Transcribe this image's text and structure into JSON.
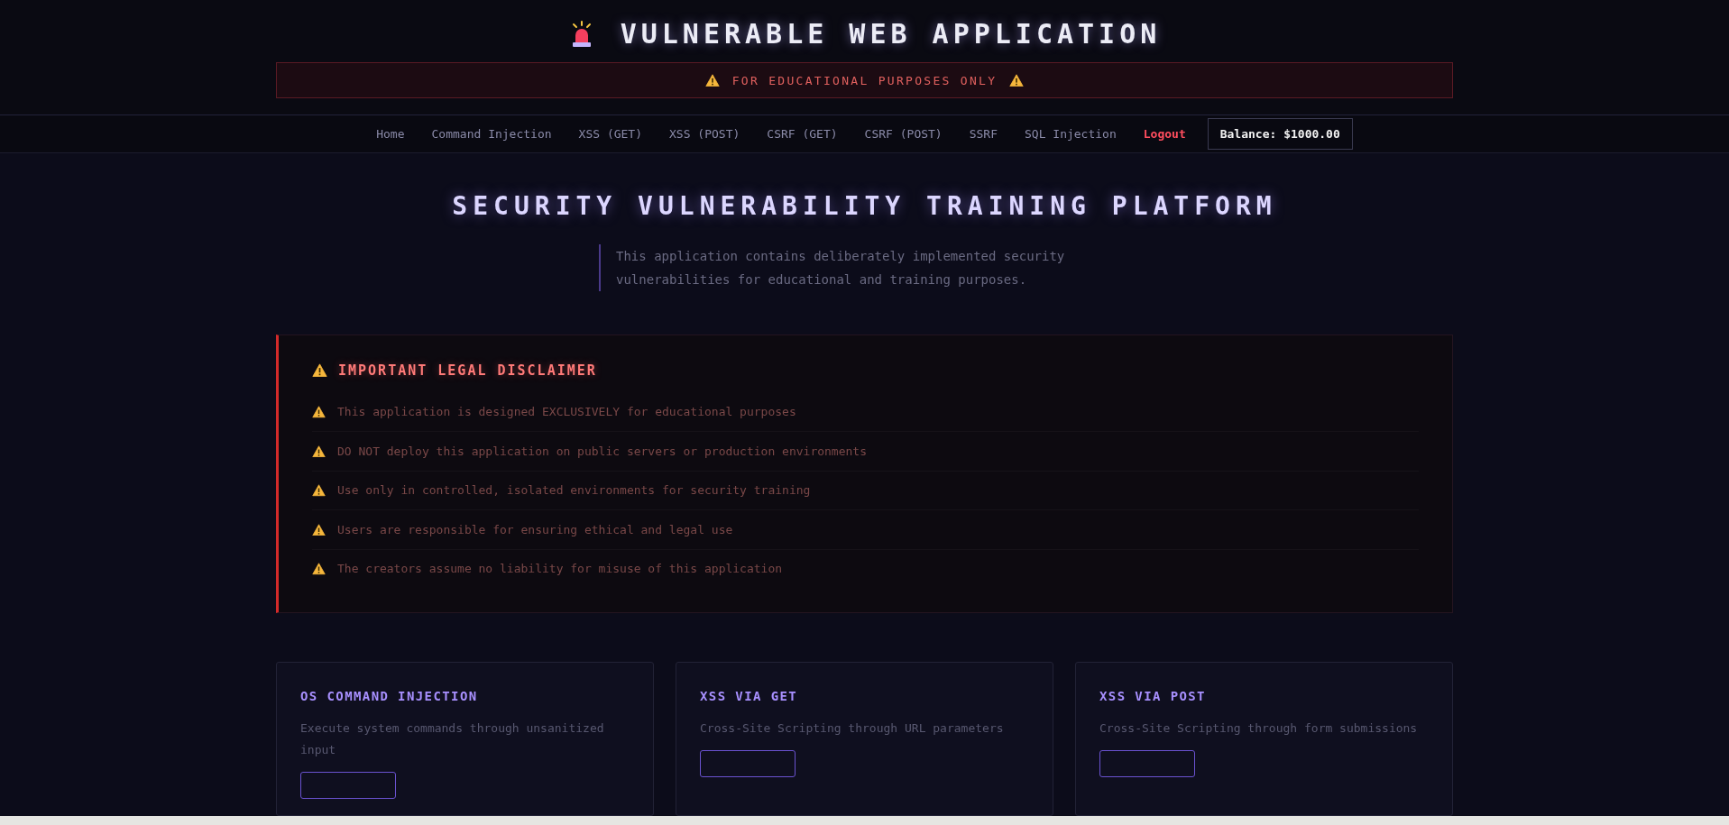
{
  "header": {
    "title": "VULNERABLE WEB APPLICATION",
    "banner": "FOR EDUCATIONAL PURPOSES ONLY"
  },
  "nav": {
    "items": [
      {
        "label": "Home",
        "kind": "link"
      },
      {
        "label": "Command Injection",
        "kind": "link"
      },
      {
        "label": "XSS (GET)",
        "kind": "link"
      },
      {
        "label": "XSS (POST)",
        "kind": "link"
      },
      {
        "label": "CSRF (GET)",
        "kind": "link"
      },
      {
        "label": "CSRF (POST)",
        "kind": "link"
      },
      {
        "label": "SSRF",
        "kind": "link"
      },
      {
        "label": "SQL Injection",
        "kind": "link"
      },
      {
        "label": "Logout",
        "kind": "logout"
      }
    ],
    "balance": "Balance: $1000.00"
  },
  "hero": {
    "title": "SECURITY VULNERABILITY TRAINING PLATFORM",
    "description": "This application contains deliberately implemented security vulnerabilities for educational and training purposes."
  },
  "disclaimer": {
    "title": "IMPORTANT LEGAL DISCLAIMER",
    "items": [
      "This application is designed EXCLUSIVELY for educational purposes",
      "DO NOT deploy this application on public servers or production environments",
      "Use only in controlled, isolated environments for security training",
      "Users are responsible for ensuring ethical and legal use",
      "The creators assume no liability for misuse of this application"
    ]
  },
  "cards": [
    {
      "title": "OS COMMAND INJECTION",
      "description": "Execute system commands through unsanitized input"
    },
    {
      "title": "XSS VIA GET",
      "description": "Cross-Site Scripting through URL parameters"
    },
    {
      "title": "XSS VIA POST",
      "description": "Cross-Site Scripting through form submissions"
    }
  ]
}
